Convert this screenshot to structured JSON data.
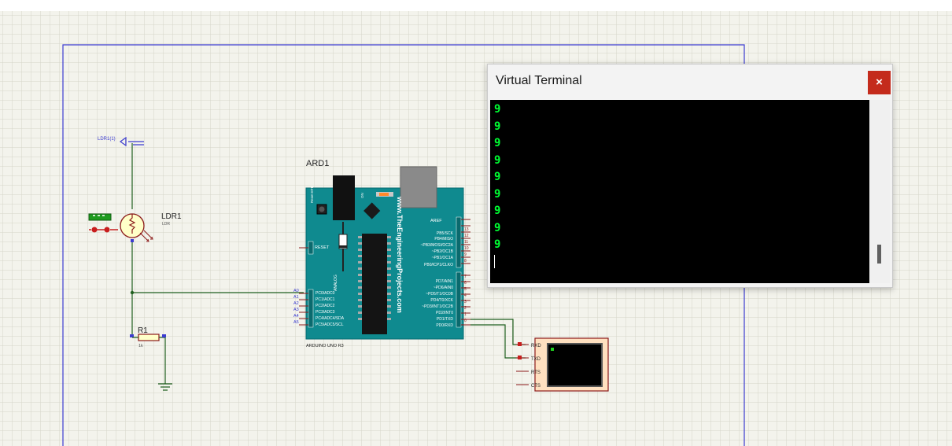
{
  "schematic": {
    "ldr_terminal_label": "LDR1(1)",
    "ldr_ref": "LDR1",
    "ldr_value": "LDR",
    "resistor_ref": "R1",
    "resistor_value": "1k",
    "board_ref": "ARD1",
    "board_name": "ARDUINO UNO R3",
    "board_website": "www.TheEngineeringProjects.com",
    "reset_btn_label": "Reset BTN",
    "reset_label": "RESET",
    "aref_label": "AREF",
    "analog_label": "ANALOG",
    "on_label": "ON",
    "analog_pins": [
      "A0",
      "A1",
      "A2",
      "A3",
      "A4",
      "A5"
    ],
    "analog_pin_labels": [
      "PC0/ADC0",
      "PC1/ADC1",
      "PC2/ADC2",
      "PC3/ADC3",
      "PC4/ADC4/SDA",
      "PC5/ADC5/SCL"
    ],
    "digital_pin_labels_top": [
      "PB5/SCK",
      "PB4/MISO",
      "~PB3/MOSI/OC2A",
      "~PB2/OC1B",
      "~PB1/OC1A",
      "PB0/ICP1/CLKO"
    ],
    "digital_pin_numbers_top": [
      "13",
      "12",
      "11",
      "10",
      "9",
      "8"
    ],
    "digital_pin_labels_bottom": [
      "PD7/AIN1",
      "~PD6/AIN0",
      "~PD5/T1/OC0B",
      "PD4/T0/XCK",
      "~PD3/INT1/OC2B",
      "PD2/INT0",
      "PD1/TXD",
      "PD0/RXD"
    ],
    "digital_pin_numbers_bottom": [
      "7",
      "6",
      "5",
      "4",
      "3",
      "2",
      "1",
      "0"
    ],
    "vt_pins": [
      "RXD",
      "TXD",
      "RTS",
      "CTS"
    ]
  },
  "terminal": {
    "title": "Virtual Terminal",
    "close_label": "×",
    "lines": [
      "9",
      "9",
      "9",
      "9",
      "9",
      "9",
      "9",
      "9",
      "9"
    ]
  },
  "colors": {
    "grid_minor": "#d5d5c9",
    "grid_major": "#b9b9ab",
    "sheet_border": "#3c3cd0",
    "wire": "#1f5f1f",
    "board": "#0f8a8f",
    "terminal_text": "#00ff33",
    "close_button": "#c42b1c"
  }
}
